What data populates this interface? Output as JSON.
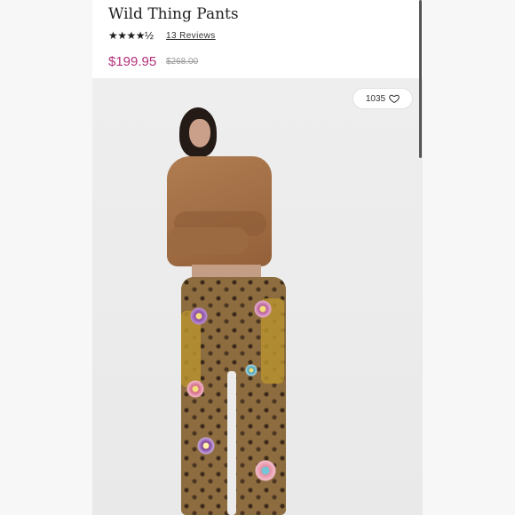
{
  "product": {
    "title": "Wild Thing Pants",
    "rating_stars": "★★★★½",
    "reviews_label": "13 Reviews",
    "price": "$199.95",
    "compare_price": "$268.00",
    "rating_value": 4.5
  },
  "photo": {
    "likes_count": "1035",
    "icon": "heart-outline-icon"
  },
  "colors": {
    "price": "#b2317a",
    "text": "#222222",
    "muted": "#999999"
  }
}
